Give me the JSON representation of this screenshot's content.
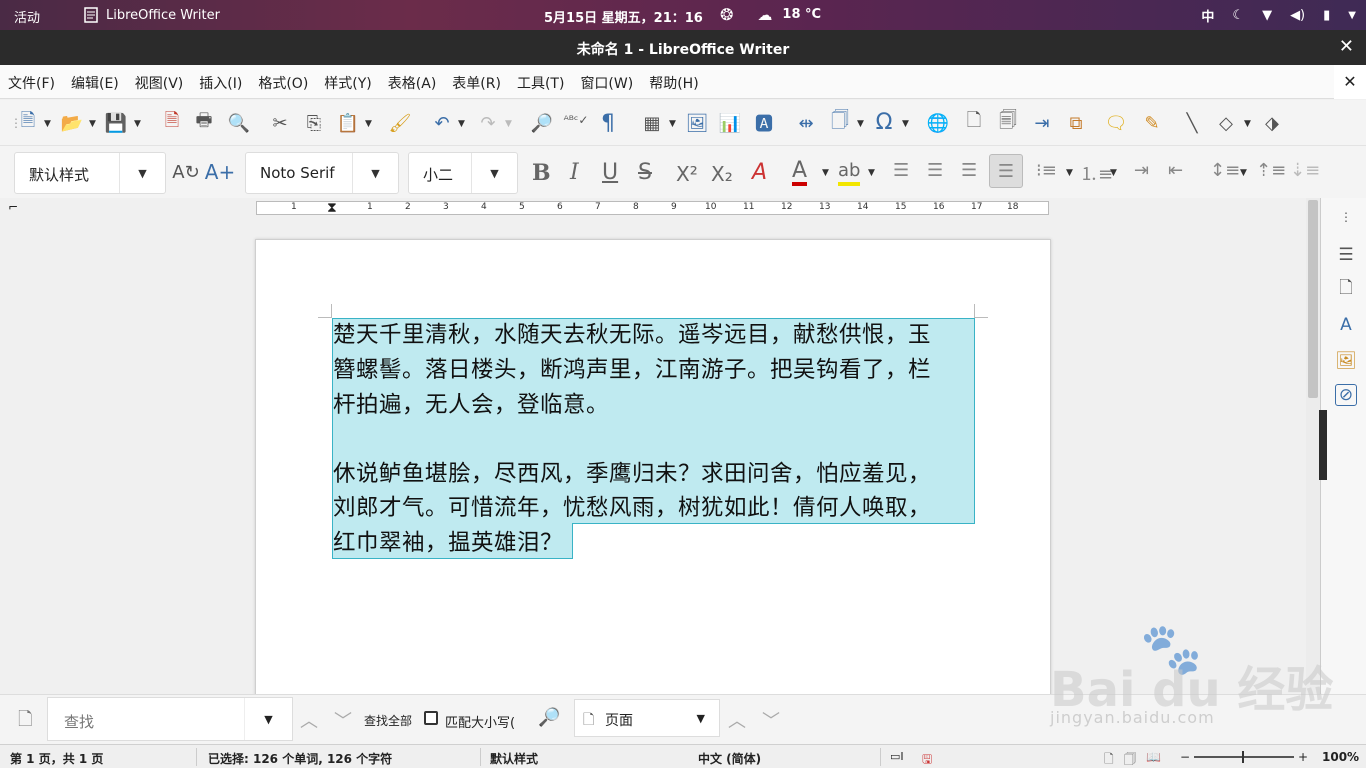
{
  "topbar": {
    "activities": "活动",
    "app_name": "LibreOffice Writer",
    "clock": "5月15日 星期五，21：16",
    "temperature": "18 °C",
    "input_method": "中"
  },
  "window": {
    "title": "未命名 1 - LibreOffice Writer"
  },
  "menu": {
    "items": [
      "文件(F)",
      "编辑(E)",
      "视图(V)",
      "插入(I)",
      "格式(O)",
      "样式(Y)",
      "表格(A)",
      "表单(R)",
      "工具(T)",
      "窗口(W)",
      "帮助(H)"
    ]
  },
  "formatting": {
    "paragraph_style": "默认样式",
    "font_name": "Noto Serif C",
    "font_size": "小二",
    "superscript_label": "X²",
    "subscript_label": "X₂"
  },
  "ruler": {
    "numbers": [
      "1",
      "1",
      "2",
      "3",
      "4",
      "5",
      "6",
      "7",
      "8",
      "9",
      "10",
      "11",
      "12",
      "13",
      "14",
      "15",
      "16",
      "17",
      "18"
    ]
  },
  "document": {
    "lines": [
      "楚天千里清秋，水随天去秋无际。遥岑远目，献愁供恨，玉",
      "簪螺髻。落日楼头，断鸿声里，江南游子。把吴钩看了，栏",
      "杆拍遍，无人会，登临意。",
      "",
      "休说鲈鱼堪脍，尽西风，季鹰归未？求田问舍，怕应羞见，",
      "刘郎才气。可惜流年，忧愁风雨，树犹如此！倩何人唤取，",
      "红巾翠袖，揾英雄泪？"
    ],
    "selection_color": "#bfeaf0"
  },
  "findbar": {
    "placeholder": "查找",
    "find_all": "查找全部",
    "match_case": "匹配大小写(",
    "search_type": "页面"
  },
  "status": {
    "page": "第 1 页，共 1 页",
    "selection": "已选择: 126 个单词, 126 个字符",
    "style": "默认样式",
    "language": "中文 (简体)",
    "zoom": "100%"
  },
  "watermark": {
    "brand": "Bai du 经验",
    "url": "jingyan.baidu.com"
  }
}
